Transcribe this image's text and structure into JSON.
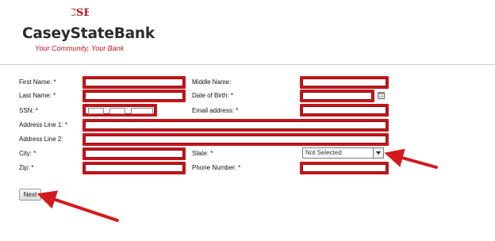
{
  "bank": {
    "logo_mark": "CSB",
    "name": "CaseyStateBank",
    "tagline": "Your Community, Your Bank"
  },
  "form": {
    "first_name_label": "First Name: *",
    "middle_name_label": "Middle Name:",
    "last_name_label": "Last Name: *",
    "dob_label": "Date of Birth: *",
    "ssn_label": "SSN: *",
    "ssn_sep1": "-",
    "ssn_sep2": "-",
    "email_label": "Email address: *",
    "address1_label": "Address Line 1: *",
    "address2_label": "Address Line 2:",
    "city_label": "City: *",
    "state_label": "State: *",
    "state_value": "Not Selected",
    "zip_label": "Zip: *",
    "phone_label": "Phone Number: *",
    "next_button": "Next"
  },
  "colors": {
    "highlight": "#c4161c",
    "brand_red": "#c0151b"
  },
  "icons": {
    "calendar": "calendar-icon",
    "dropdown": "chevron-down-icon"
  }
}
